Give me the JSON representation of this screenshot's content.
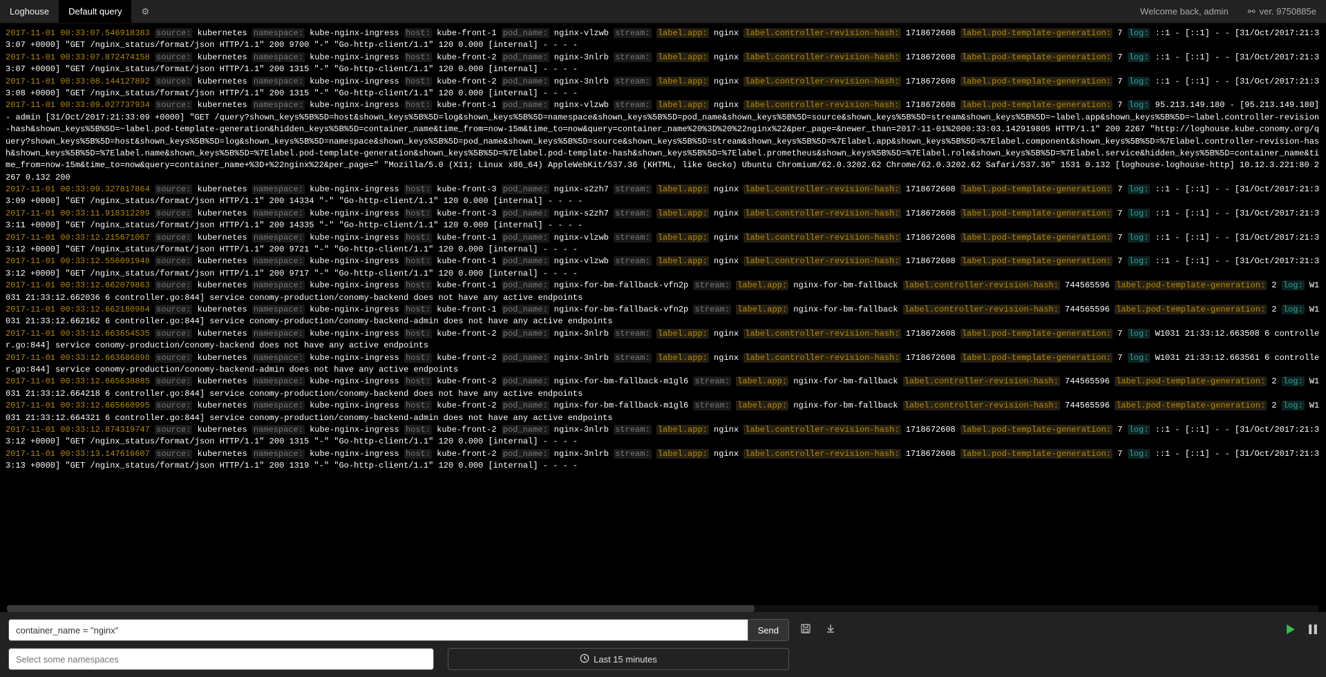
{
  "topbar": {
    "brand": "Loghouse",
    "tab": "Default query",
    "welcome": "Welcome back, admin",
    "version": "ver. 9750885e"
  },
  "fields": {
    "source": "source:",
    "namespace": "namespace:",
    "host": "host:",
    "pod_name": "pod_name:",
    "stream": "stream:",
    "label_app": "label.app:",
    "label_crh": "label.controller-revision-hash:",
    "label_ptg": "label.pod-template-generation:",
    "log": "log:"
  },
  "rows": [
    {
      "ts": "2017-11-01 00:33:07.546918383",
      "source": "kubernetes",
      "namespace": "kube-nginx-ingress",
      "host": "kube-front-1",
      "pod": "nginx-vlzwb",
      "stream": "",
      "app": "nginx",
      "crh": "1718672608",
      "ptg": "7",
      "log": "::1 - [::1] - - [31/Oct/2017:21:33:07 +0000] \"GET /nginx_status/format/json HTTP/1.1\" 200 9700 \"-\" \"Go-http-client/1.1\" 120 0.000 [internal] - - - -"
    },
    {
      "ts": "2017-11-01 00:33:07.872474158",
      "source": "kubernetes",
      "namespace": "kube-nginx-ingress",
      "host": "kube-front-2",
      "pod": "nginx-3nlrb",
      "stream": "",
      "app": "nginx",
      "crh": "1718672608",
      "ptg": "7",
      "log": "::1 - [::1] - - [31/Oct/2017:21:33:07 +0000] \"GET /nginx_status/format/json HTTP/1.1\" 200 1315 \"-\" \"Go-http-client/1.1\" 120 0.000 [internal] - - - -"
    },
    {
      "ts": "2017-11-01 00:33:08.144127892",
      "source": "kubernetes",
      "namespace": "kube-nginx-ingress",
      "host": "kube-front-2",
      "pod": "nginx-3nlrb",
      "stream": "",
      "app": "nginx",
      "crh": "1718672608",
      "ptg": "7",
      "log": "::1 - [::1] - - [31/Oct/2017:21:33:08 +0000] \"GET /nginx_status/format/json HTTP/1.1\" 200 1315 \"-\" \"Go-http-client/1.1\" 120 0.000 [internal] - - - -"
    },
    {
      "ts": "2017-11-01 00:33:09.027737934",
      "source": "kubernetes",
      "namespace": "kube-nginx-ingress",
      "host": "kube-front-1",
      "pod": "nginx-vlzwb",
      "stream": "",
      "app": "nginx",
      "crh": "1718672608",
      "ptg": "7",
      "log": "95.213.149.180 - [95.213.149.180] - admin [31/Oct/2017:21:33:09 +0000] \"GET /query?shown_keys%5B%5D=host&shown_keys%5B%5D=log&shown_keys%5B%5D=namespace&shown_keys%5B%5D=pod_name&shown_keys%5B%5D=source&shown_keys%5B%5D=stream&shown_keys%5B%5D=~label.app&shown_keys%5B%5D=~label.controller-revision-hash&shown_keys%5B%5D=~label.pod-template-generation&hidden_keys%5B%5D=container_name&time_from=now-15m&time_to=now&query=container_name%20%3D%20%22nginx%22&per_page=&newer_than=2017-11-01%2000:33:03.142919805 HTTP/1.1\" 200 2267 \"http://loghouse.kube.conomy.org/query?shown_keys%5B%5D=host&shown_keys%5B%5D=log&shown_keys%5B%5D=namespace&shown_keys%5B%5D=pod_name&shown_keys%5B%5D=source&shown_keys%5B%5D=stream&shown_keys%5B%5D=%7Elabel.app&shown_keys%5B%5D=%7Elabel.component&shown_keys%5B%5D=%7Elabel.controller-revision-hash&shown_keys%5B%5D=%7Elabel.name&shown_keys%5B%5D=%7Elabel.pod-template-generation&shown_keys%5B%5D=%7Elabel.pod-template-hash&shown_keys%5B%5D=%7Elabel.prometheus&shown_keys%5B%5D=%7Elabel.role&shown_keys%5B%5D=%7Elabel.service&hidden_keys%5B%5D=container_name&time_from=now-15m&time_to=now&query=container_name+%3D+%22nginx%22&per_page=\" \"Mozilla/5.0 (X11; Linux x86_64) AppleWebKit/537.36 (KHTML, like Gecko) Ubuntu Chromium/62.0.3202.62 Chrome/62.0.3202.62 Safari/537.36\" 1531 0.132 [loghouse-loghouse-http] 10.12.3.221:80 2267 0.132 200"
    },
    {
      "ts": "2017-11-01 00:33:09.327817864",
      "source": "kubernetes",
      "namespace": "kube-nginx-ingress",
      "host": "kube-front-3",
      "pod": "nginx-s2zh7",
      "stream": "",
      "app": "nginx",
      "crh": "1718672608",
      "ptg": "7",
      "log": "::1 - [::1] - - [31/Oct/2017:21:33:09 +0000] \"GET /nginx_status/format/json HTTP/1.1\" 200 14334 \"-\" \"Go-http-client/1.1\" 120 0.000 [internal] - - - -"
    },
    {
      "ts": "2017-11-01 00:33:11.918312289",
      "source": "kubernetes",
      "namespace": "kube-nginx-ingress",
      "host": "kube-front-3",
      "pod": "nginx-s2zh7",
      "stream": "",
      "app": "nginx",
      "crh": "1718672608",
      "ptg": "7",
      "log": "::1 - [::1] - - [31/Oct/2017:21:33:11 +0000] \"GET /nginx_status/format/json HTTP/1.1\" 200 14335 \"-\" \"Go-http-client/1.1\" 120 0.000 [internal] - - - -"
    },
    {
      "ts": "2017-11-01 00:33:12.215671067",
      "source": "kubernetes",
      "namespace": "kube-nginx-ingress",
      "host": "kube-front-1",
      "pod": "nginx-vlzwb",
      "stream": "",
      "app": "nginx",
      "crh": "1718672608",
      "ptg": "7",
      "log": "::1 - [::1] - - [31/Oct/2017:21:33:12 +0000] \"GET /nginx_status/format/json HTTP/1.1\" 200 9721 \"-\" \"Go-http-client/1.1\" 120 0.000 [internal] - - - -"
    },
    {
      "ts": "2017-11-01 00:33:12.556091948",
      "source": "kubernetes",
      "namespace": "kube-nginx-ingress",
      "host": "kube-front-1",
      "pod": "nginx-vlzwb",
      "stream": "",
      "app": "nginx",
      "crh": "1718672608",
      "ptg": "7",
      "log": "::1 - [::1] - - [31/Oct/2017:21:33:12 +0000] \"GET /nginx_status/format/json HTTP/1.1\" 200 9717 \"-\" \"Go-http-client/1.1\" 120 0.000 [internal] - - - -"
    },
    {
      "ts": "2017-11-01 00:33:12.662079863",
      "source": "kubernetes",
      "namespace": "kube-nginx-ingress",
      "host": "kube-front-1",
      "pod": "nginx-for-bm-fallback-vfn2p",
      "stream": "",
      "app": "nginx-for-bm-fallback",
      "crh": "744565596",
      "ptg": "2",
      "log": "W1031 21:33:12.662036 6 controller.go:844] service conomy-production/conomy-backend does not have any active endpoints"
    },
    {
      "ts": "2017-11-01 00:33:12.662180984",
      "source": "kubernetes",
      "namespace": "kube-nginx-ingress",
      "host": "kube-front-1",
      "pod": "nginx-for-bm-fallback-vfn2p",
      "stream": "",
      "app": "nginx-for-bm-fallback",
      "crh": "744565596",
      "ptg": "2",
      "log": "W1031 21:33:12.662162 6 controller.go:844] service conomy-production/conomy-backend-admin does not have any active endpoints"
    },
    {
      "ts": "2017-11-01 00:33:12.663654535",
      "source": "kubernetes",
      "namespace": "kube-nginx-ingress",
      "host": "kube-front-2",
      "pod": "nginx-3nlrb",
      "stream": "",
      "app": "nginx",
      "crh": "1718672608",
      "ptg": "7",
      "log": "W1031 21:33:12.663508 6 controller.go:844] service conomy-production/conomy-backend does not have any active endpoints"
    },
    {
      "ts": "2017-11-01 00:33:12.663686898",
      "source": "kubernetes",
      "namespace": "kube-nginx-ingress",
      "host": "kube-front-2",
      "pod": "nginx-3nlrb",
      "stream": "",
      "app": "nginx",
      "crh": "1718672608",
      "ptg": "7",
      "log": "W1031 21:33:12.663561 6 controller.go:844] service conomy-production/conomy-backend-admin does not have any active endpoints"
    },
    {
      "ts": "2017-11-01 00:33:12.665638885",
      "source": "kubernetes",
      "namespace": "kube-nginx-ingress",
      "host": "kube-front-2",
      "pod": "nginx-for-bm-fallback-m1gl6",
      "stream": "",
      "app": "nginx-for-bm-fallback",
      "crh": "744565596",
      "ptg": "2",
      "log": "W1031 21:33:12.664218 6 controller.go:844] service conomy-production/conomy-backend does not have any active endpoints"
    },
    {
      "ts": "2017-11-01 00:33:12.665660995",
      "source": "kubernetes",
      "namespace": "kube-nginx-ingress",
      "host": "kube-front-2",
      "pod": "nginx-for-bm-fallback-m1gl6",
      "stream": "",
      "app": "nginx-for-bm-fallback",
      "crh": "744565596",
      "ptg": "2",
      "log": "W1031 21:33:12.664321 6 controller.go:844] service conomy-production/conomy-backend-admin does not have any active endpoints"
    },
    {
      "ts": "2017-11-01 00:33:12.874319747",
      "source": "kubernetes",
      "namespace": "kube-nginx-ingress",
      "host": "kube-front-2",
      "pod": "nginx-3nlrb",
      "stream": "",
      "app": "nginx",
      "crh": "1718672608",
      "ptg": "7",
      "log": "::1 - [::1] - - [31/Oct/2017:21:33:12 +0000] \"GET /nginx_status/format/json HTTP/1.1\" 200 1315 \"-\" \"Go-http-client/1.1\" 120 0.000 [internal] - - - -"
    },
    {
      "ts": "2017-11-01 00:33:13.147616607",
      "source": "kubernetes",
      "namespace": "kube-nginx-ingress",
      "host": "kube-front-2",
      "pod": "nginx-3nlrb",
      "stream": "",
      "app": "nginx",
      "crh": "1718672608",
      "ptg": "7",
      "log": "::1 - [::1] - - [31/Oct/2017:21:33:13 +0000] \"GET /nginx_status/format/json HTTP/1.1\" 200 1319 \"-\" \"Go-http-client/1.1\" 120 0.000 [internal] - - - -"
    }
  ],
  "bottom": {
    "query": "container_name = \"nginx\"",
    "send": "Send",
    "ns_placeholder": "Select some namespaces",
    "time": "Last 15 minutes"
  }
}
